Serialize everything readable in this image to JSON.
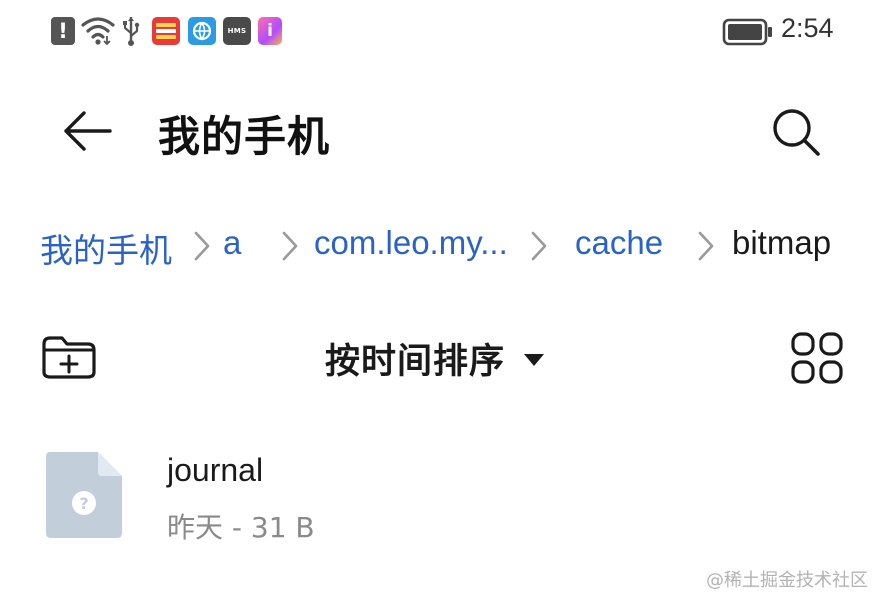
{
  "status_bar": {
    "time": "2:54",
    "alert_glyph": "!",
    "app3_label": "HMS",
    "app4_label": "i",
    "icons": [
      "alert-icon",
      "wifi-icon",
      "usb-icon",
      "app-notification-icon",
      "browser-icon",
      "hms-icon",
      "app-store-icon",
      "battery-icon"
    ]
  },
  "header": {
    "title": "我的手机",
    "back_icon": "arrow-left-icon",
    "search_icon": "search-icon"
  },
  "breadcrumb": {
    "items": [
      {
        "label": "我的手机"
      },
      {
        "label": "a"
      },
      {
        "label": "com.leo.my..."
      },
      {
        "label": "cache"
      },
      {
        "label": "bitmap"
      }
    ]
  },
  "toolbar": {
    "new_folder_icon": "new-folder-icon",
    "sort_label": "按时间排序",
    "grid_icon": "grid-view-icon"
  },
  "files": [
    {
      "name": "journal",
      "meta": "昨天 - 31 B",
      "icon": "unknown-file-icon",
      "icon_glyph": "?"
    }
  ],
  "watermark": "@稀土掘金技术社区",
  "colors": {
    "link": "#2a62c9",
    "text": "#1a1a1a",
    "secondary": "#8a8a8a",
    "file_icon": "#c3cedb"
  }
}
